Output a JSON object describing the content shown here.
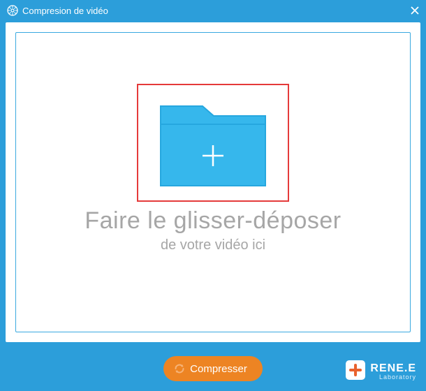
{
  "window": {
    "title": "Compresion de vidéo"
  },
  "dropzone": {
    "title": "Faire le glisser-déposer",
    "subtitle": "de votre vidéo ici"
  },
  "footer": {
    "compress_label": "Compresser"
  },
  "brand": {
    "name": "RENE.E",
    "sub": "Laboratory"
  },
  "colors": {
    "accent": "#2c9eda",
    "folder": "#36b7ec",
    "button": "#ed8423",
    "highlight_frame": "#e53a3a"
  }
}
